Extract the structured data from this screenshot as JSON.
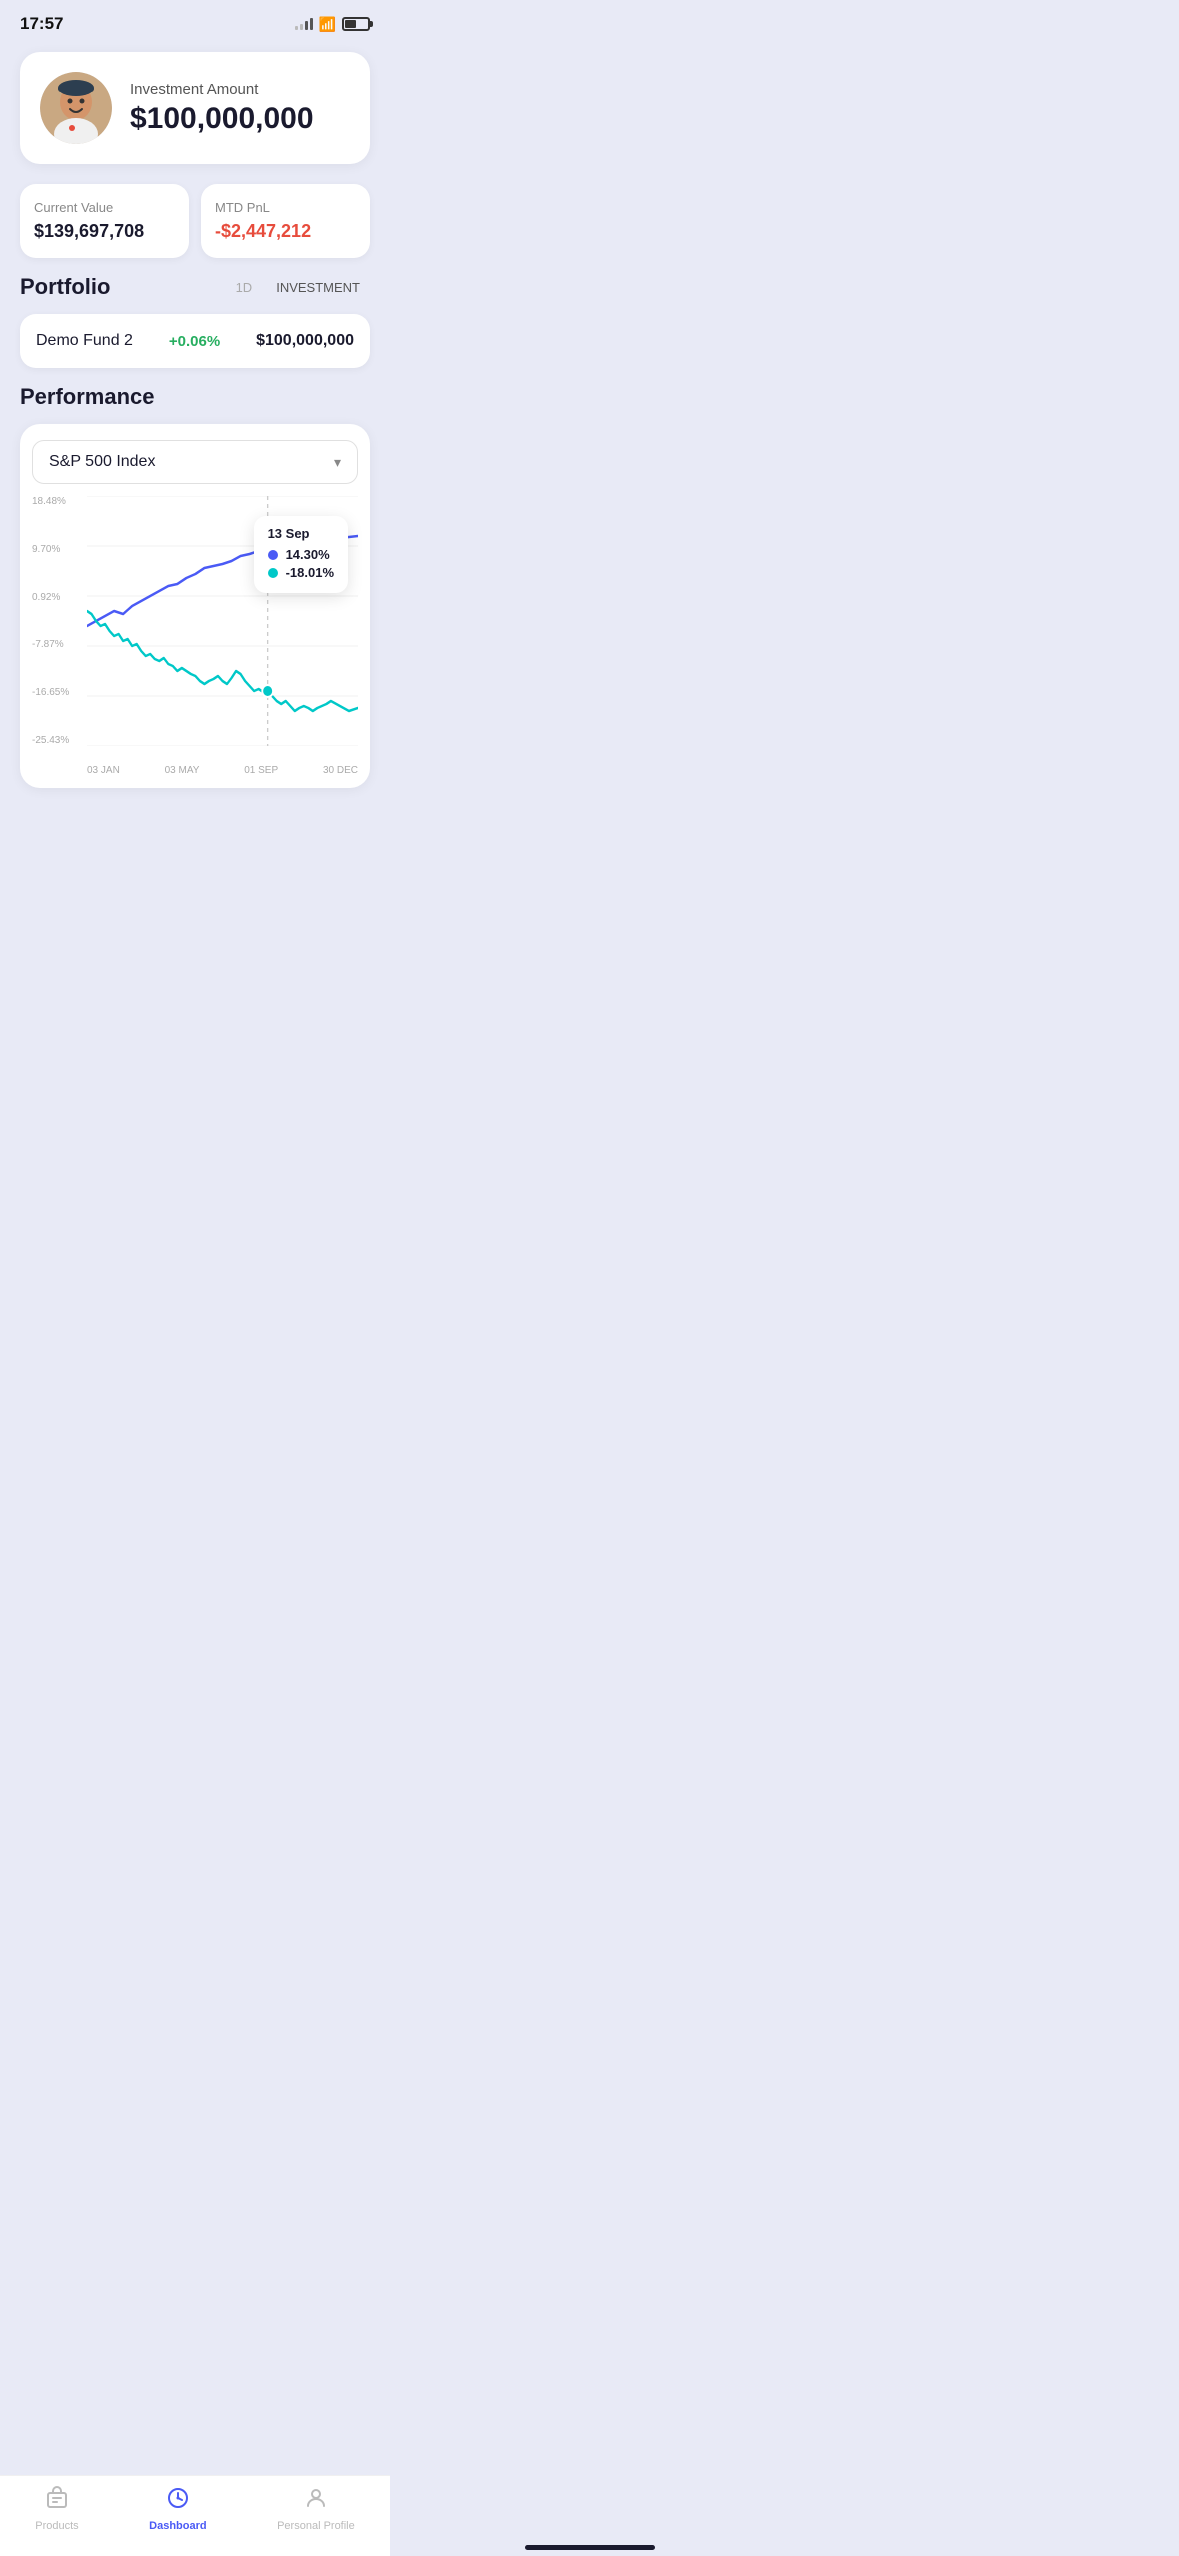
{
  "statusBar": {
    "time": "17:57"
  },
  "header": {
    "investmentLabel": "Investment Amount",
    "investmentAmount": "$100,000,000"
  },
  "stats": {
    "currentValueLabel": "Current Value",
    "currentValue": "$139,697,708",
    "mtdPnlLabel": "MTD PnL",
    "mtdPnl": "-$2,447,212"
  },
  "portfolio": {
    "title": "Portfolio",
    "tabs": [
      {
        "label": "1D",
        "active": false
      },
      {
        "label": "INVESTMENT",
        "active": true
      }
    ],
    "fund": {
      "name": "Demo Fund 2",
      "change": "+0.06%",
      "value": "$100,000,000"
    }
  },
  "performance": {
    "title": "Performance",
    "dropdown": "S&P 500 Index",
    "yLabels": [
      "18.48%",
      "9.70%",
      "0.92%",
      "-7.87%",
      "-16.65%",
      "-25.43%"
    ],
    "xLabels": [
      "03 JAN",
      "03 MAY",
      "01 SEP",
      "30 DEC"
    ],
    "tooltip": {
      "date": "13 Sep",
      "series1": {
        "color": "#4a5af5",
        "value": "14.30%"
      },
      "series2": {
        "color": "#00c8c8",
        "value": "-18.01%"
      }
    }
  },
  "bottomNav": {
    "items": [
      {
        "label": "Products",
        "active": false
      },
      {
        "label": "Dashboard",
        "active": true
      },
      {
        "label": "Personal Profile",
        "active": false
      }
    ]
  }
}
